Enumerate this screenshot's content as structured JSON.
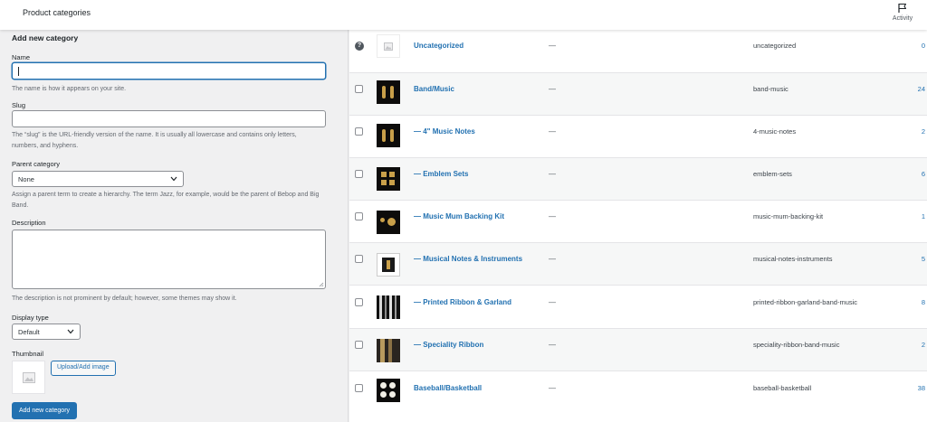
{
  "topbar": {
    "title": "Product categories",
    "activity_label": "Activity"
  },
  "form": {
    "heading": "Add new category",
    "name_label": "Name",
    "name_value": "",
    "name_help": "The name is how it appears on your site.",
    "slug_label": "Slug",
    "slug_value": "",
    "slug_help": "The “slug” is the URL-friendly version of the name. It is usually all lowercase and contains only letters, numbers, and hyphens.",
    "parent_label": "Parent category",
    "parent_value": "None",
    "parent_help": "Assign a parent term to create a hierarchy. The term Jazz, for example, would be the parent of Bebop and Big Band.",
    "description_label": "Description",
    "description_value": "",
    "description_help": "The description is not prominent by default; however, some themes may show it.",
    "display_type_label": "Display type",
    "display_type_value": "Default",
    "thumbnail_label": "Thumbnail",
    "upload_button": "Upload/Add image",
    "submit_button": "Add new category"
  },
  "table": {
    "rows": [
      {
        "name": "Uncategorized",
        "description": "—",
        "slug": "uncategorized",
        "count": "0",
        "thumb": "placeholder",
        "checkbox": "help-icon"
      },
      {
        "name": "Band/Music",
        "description": "—",
        "slug": "band-music",
        "count": "24",
        "thumb": "music-notes"
      },
      {
        "name": "— 4\" Music Notes",
        "description": "—",
        "slug": "4-music-notes",
        "count": "2",
        "thumb": "music-notes"
      },
      {
        "name": "— Emblem Sets",
        "description": "—",
        "slug": "emblem-sets",
        "count": "6",
        "thumb": "emblem-sets"
      },
      {
        "name": "— Music Mum Backing Kit",
        "description": "—",
        "slug": "music-mum-backing-kit",
        "count": "1",
        "thumb": "backing-kit"
      },
      {
        "name": "— Musical Notes & Instruments",
        "description": "—",
        "slug": "musical-notes-instruments",
        "count": "5",
        "thumb": "instrument"
      },
      {
        "name": "— Printed Ribbon & Garland",
        "description": "—",
        "slug": "printed-ribbon-garland-band-music",
        "count": "8",
        "thumb": "ribbon"
      },
      {
        "name": "— Speciality Ribbon",
        "description": "—",
        "slug": "speciality-ribbon-band-music",
        "count": "2",
        "thumb": "ribbon-gold"
      },
      {
        "name": "Baseball/Basketball",
        "description": "—",
        "slug": "baseball-basketball",
        "count": "38",
        "thumb": "baseball"
      }
    ]
  },
  "colors": {
    "accent": "#2271b1",
    "background": "#f0f0f1",
    "text": "#1d2327"
  }
}
